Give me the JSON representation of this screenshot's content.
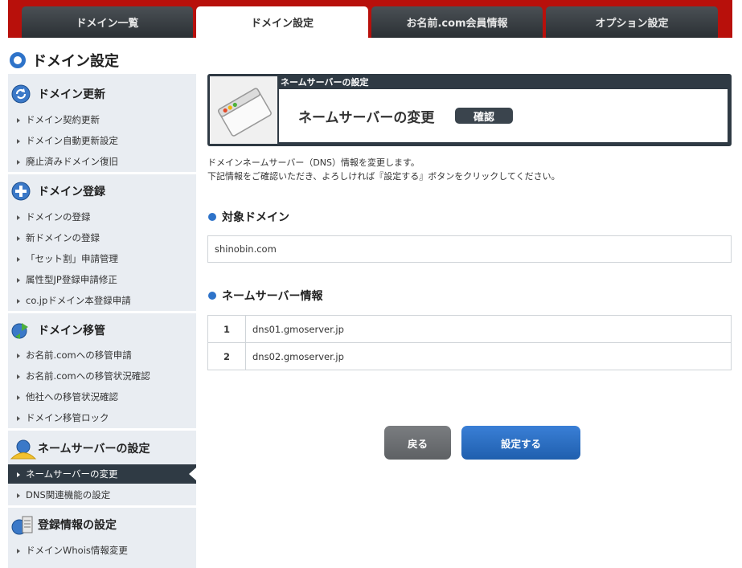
{
  "tabs": [
    {
      "label": "ドメイン一覧"
    },
    {
      "label": "ドメイン設定"
    },
    {
      "label": "お名前.com会員情報"
    },
    {
      "label": "オプション設定"
    }
  ],
  "page_title": "ドメイン設定",
  "sidebar": {
    "sections": [
      {
        "title": "ドメイン更新",
        "items": [
          "ドメイン契約更新",
          "ドメイン自動更新設定",
          "廃止済みドメイン復旧"
        ]
      },
      {
        "title": "ドメイン登録",
        "items": [
          "ドメインの登録",
          "新ドメインの登録",
          "「セット割」申請管理",
          "属性型JP登録申請修正",
          "co.jpドメイン本登録申請"
        ]
      },
      {
        "title": "ドメイン移管",
        "items": [
          "お名前.comへの移管申請",
          "お名前.comへの移管状況確認",
          "他社への移管状況確認",
          "ドメイン移管ロック"
        ]
      },
      {
        "title": "ネームサーバーの設定",
        "items": [
          "ネームサーバーの変更",
          "DNS関連機能の設定"
        ]
      },
      {
        "title": "登録情報の設定",
        "items": [
          "ドメインWhois情報変更"
        ]
      }
    ],
    "active_item": "ネームサーバーの変更"
  },
  "main": {
    "box_label": "ネームサーバーの設定",
    "title": "ネームサーバーの変更",
    "badge": "確認",
    "description_line1": "ドメインネームサーバー（DNS）情報を変更します。",
    "description_line2": "下記情報をご確認いただき、よろしければ『設定する』ボタンをクリックしてください。",
    "target_domain_heading": "対象ドメイン",
    "target_domain": "shinobin.com",
    "ns_heading": "ネームサーバー情報",
    "nameservers": [
      {
        "num": "1",
        "host": "dns01.gmoserver.jp"
      },
      {
        "num": "2",
        "host": "dns02.gmoserver.jp"
      }
    ],
    "back_label": "戻る",
    "submit_label": "設定する"
  },
  "colors": {
    "brand_red": "#b8100b",
    "accent_blue": "#2e73c9",
    "dark_nav": "#2f3a44"
  },
  "icons": [
    "refresh-icon",
    "plus-icon",
    "transfer-icon",
    "nameserver-icon",
    "database-icon",
    "window-icon"
  ]
}
